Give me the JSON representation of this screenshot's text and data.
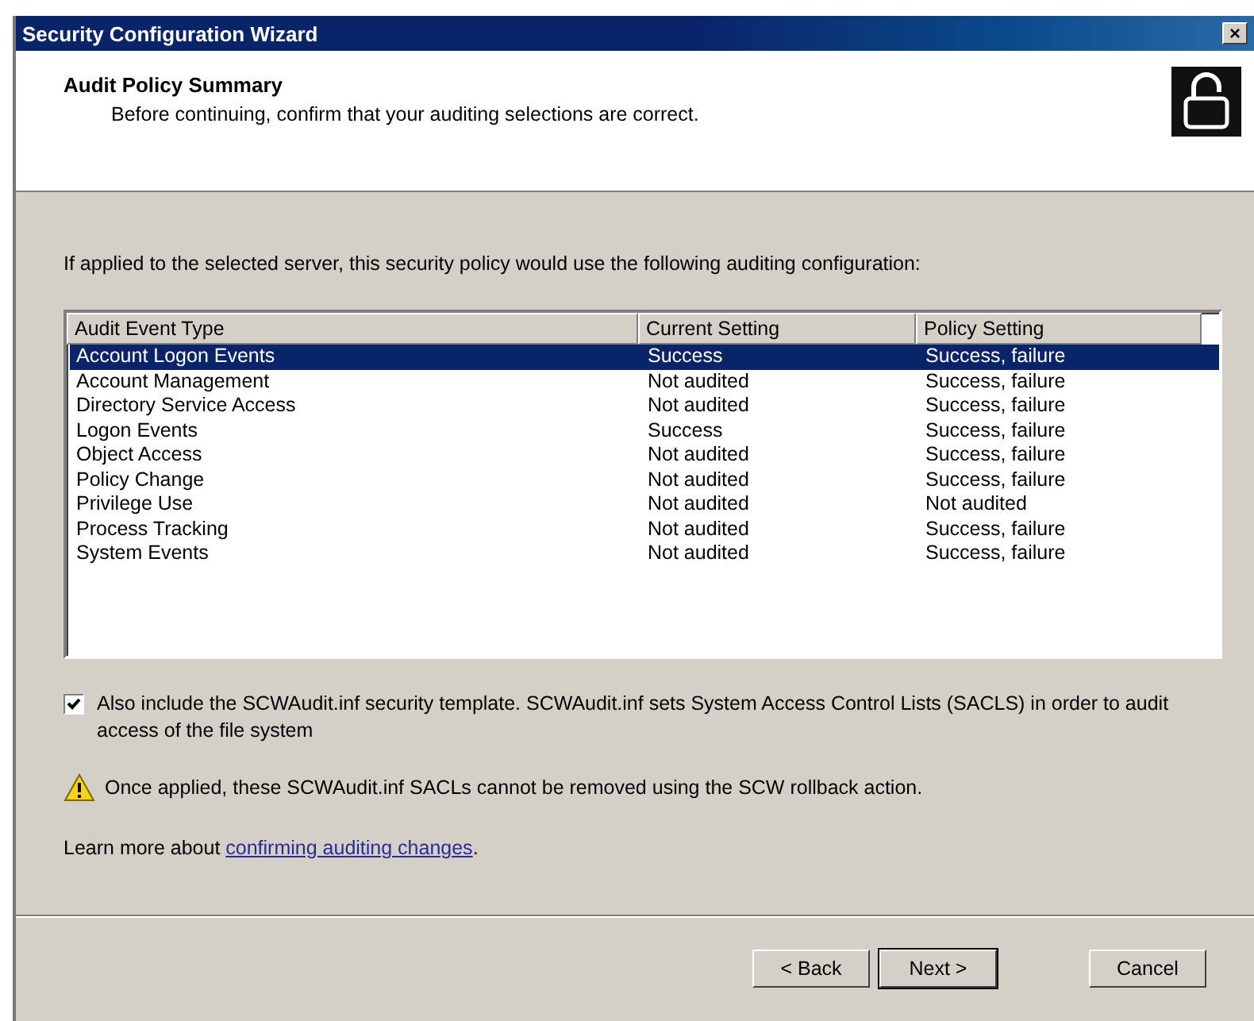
{
  "window": {
    "title": "Security Configuration Wizard",
    "close": "×"
  },
  "header": {
    "title": "Audit Policy Summary",
    "subtitle": "Before continuing, confirm that your auditing selections are correct."
  },
  "intro": "If applied to the selected server, this security policy would use the following auditing configuration:",
  "table": {
    "columns": [
      "Audit Event Type",
      "Current Setting",
      "Policy Setting"
    ],
    "rows": [
      {
        "cells": [
          "Account Logon Events",
          "Success",
          "Success, failure"
        ],
        "selected": true
      },
      {
        "cells": [
          "Account Management",
          "Not audited",
          "Success, failure"
        ],
        "selected": false
      },
      {
        "cells": [
          "Directory Service Access",
          "Not audited",
          "Success, failure"
        ],
        "selected": false
      },
      {
        "cells": [
          "Logon Events",
          "Success",
          "Success, failure"
        ],
        "selected": false
      },
      {
        "cells": [
          "Object Access",
          "Not audited",
          "Success, failure"
        ],
        "selected": false
      },
      {
        "cells": [
          "Policy Change",
          "Not audited",
          "Success, failure"
        ],
        "selected": false
      },
      {
        "cells": [
          "Privilege Use",
          "Not audited",
          "Not audited"
        ],
        "selected": false
      },
      {
        "cells": [
          "Process Tracking",
          "Not audited",
          "Success, failure"
        ],
        "selected": false
      },
      {
        "cells": [
          "System Events",
          "Not audited",
          "Success, failure"
        ],
        "selected": false
      }
    ]
  },
  "include_template": {
    "checked": true,
    "label": "Also include the SCWAudit.inf security template. SCWAudit.inf sets System Access Control Lists (SACLS) in order to audit access of the file system"
  },
  "warning": "Once applied, these SCWAudit.inf SACLs cannot be removed using the SCW rollback action.",
  "learn_more": {
    "prefix": "Learn more about ",
    "link": "confirming auditing changes",
    "suffix": "."
  },
  "buttons": [
    {
      "label": "< Back",
      "default": false
    },
    {
      "label": "Next >",
      "default": true
    },
    {
      "label": "Cancel",
      "default": false
    }
  ]
}
